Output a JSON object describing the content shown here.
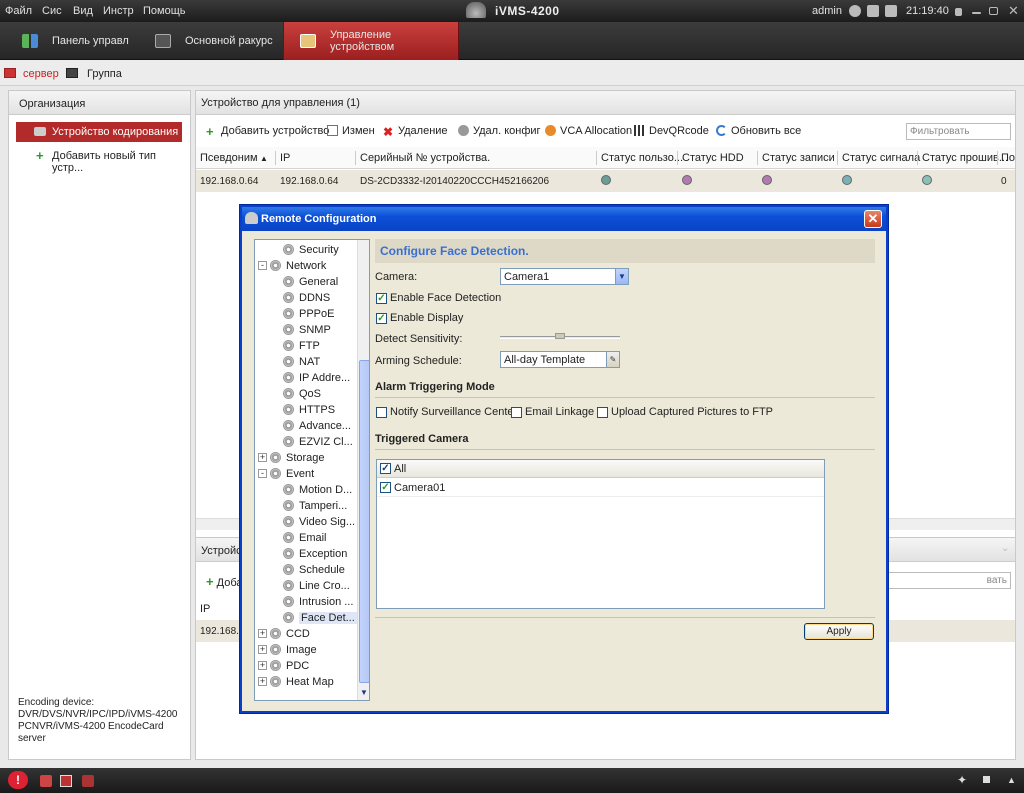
{
  "menu": {
    "items": [
      "Файл",
      "Сис",
      "Вид",
      "Инстр",
      "Помощь"
    ]
  },
  "app": {
    "title": "iVMS-4200",
    "user": "admin",
    "time": "21:19:40"
  },
  "tabs": [
    {
      "label": "Панель управл"
    },
    {
      "label": "Основной ракурс"
    },
    {
      "label": "Управление устройством"
    }
  ],
  "subtabs": [
    {
      "label": "сервер"
    },
    {
      "label": "Группа"
    }
  ],
  "left": {
    "title": "Организация",
    "selected": "Устройство кодирования",
    "add": "Добавить новый тип устр...",
    "note": "Encoding device: DVR/DVS/NVR/IPC/IPD/iVMS-4200 PCNVR/iVMS-4200 EncodeCard server"
  },
  "right": {
    "title": "Устройство для управления (1)",
    "toolbar": {
      "add": "Добавить устройство",
      "edit": "Измен",
      "delete": "Удаление",
      "remote": "Удал. конфиг",
      "vca": "VCA Allocation",
      "qr": "DevQRcode",
      "refresh": "Обновить все",
      "filter_placeholder": "Фильтровать"
    },
    "columns": [
      "Псевдоним",
      "IP",
      "Серийный № устройства.",
      "Статус пользо...",
      "Статус HDD",
      "Статус записи",
      "Статус сигнала",
      "Статус прошив...",
      "По"
    ],
    "row": {
      "alias": "192.168.0.64",
      "ip": "192.168.0.64",
      "serial": "DS-2CD3332-I20140220CCCH452166206",
      "last": "0"
    },
    "status_colors": [
      "#6a9c98",
      "#b27ab0",
      "#b27ab0",
      "#7ab0b8",
      "#8ac0b8"
    ]
  },
  "lower": {
    "title": "Устройс",
    "add": "Доба",
    "filter": "вать",
    "col": "IP",
    "row_ip": "192.168.0"
  },
  "dialog": {
    "title": "Remote Configuration",
    "tree": [
      {
        "label": "Security",
        "level": 2
      },
      {
        "label": "Network",
        "level": 1,
        "expand": "-"
      },
      {
        "label": "General",
        "level": 2
      },
      {
        "label": "DDNS",
        "level": 2
      },
      {
        "label": "PPPoE",
        "level": 2
      },
      {
        "label": "SNMP",
        "level": 2
      },
      {
        "label": "FTP",
        "level": 2
      },
      {
        "label": "NAT",
        "level": 2
      },
      {
        "label": "IP Addre...",
        "level": 2
      },
      {
        "label": "QoS",
        "level": 2
      },
      {
        "label": "HTTPS",
        "level": 2
      },
      {
        "label": "Advance...",
        "level": 2
      },
      {
        "label": "EZVIZ Cl...",
        "level": 2
      },
      {
        "label": "Storage",
        "level": 1,
        "expand": "+"
      },
      {
        "label": "Event",
        "level": 1,
        "expand": "-"
      },
      {
        "label": "Motion D...",
        "level": 2
      },
      {
        "label": "Tamperi...",
        "level": 2
      },
      {
        "label": "Video Sig...",
        "level": 2
      },
      {
        "label": "Email",
        "level": 2
      },
      {
        "label": "Exception",
        "level": 2
      },
      {
        "label": "Schedule",
        "level": 2
      },
      {
        "label": "Line Cro...",
        "level": 2
      },
      {
        "label": "Intrusion ...",
        "level": 2
      },
      {
        "label": "Face Det...",
        "level": 2,
        "selected": true
      },
      {
        "label": "CCD",
        "level": 1,
        "expand": "+"
      },
      {
        "label": "Image",
        "level": 1,
        "expand": "+"
      },
      {
        "label": "PDC",
        "level": 1,
        "expand": "+"
      },
      {
        "label": "Heat Map",
        "level": 1,
        "expand": "+"
      }
    ],
    "heading": "Configure Face Detection.",
    "camera_label": "Camera:",
    "camera_value": "Camera1",
    "enable_face": "Enable Face Detection",
    "enable_display": "Enable Display",
    "sensitivity_label": "Detect Sensitivity:",
    "sensitivity_level": 0.5,
    "schedule_label": "Arming Schedule:",
    "schedule_value": "All-day Template",
    "alarm_mode": "Alarm Triggering Mode",
    "notify": "Notify Surveillance Center",
    "email": "Email Linkage",
    "upload": "Upload Captured Pictures to FTP",
    "triggered": "Triggered Camera",
    "all": "All",
    "camera01": "Camera01",
    "apply": "Apply"
  }
}
